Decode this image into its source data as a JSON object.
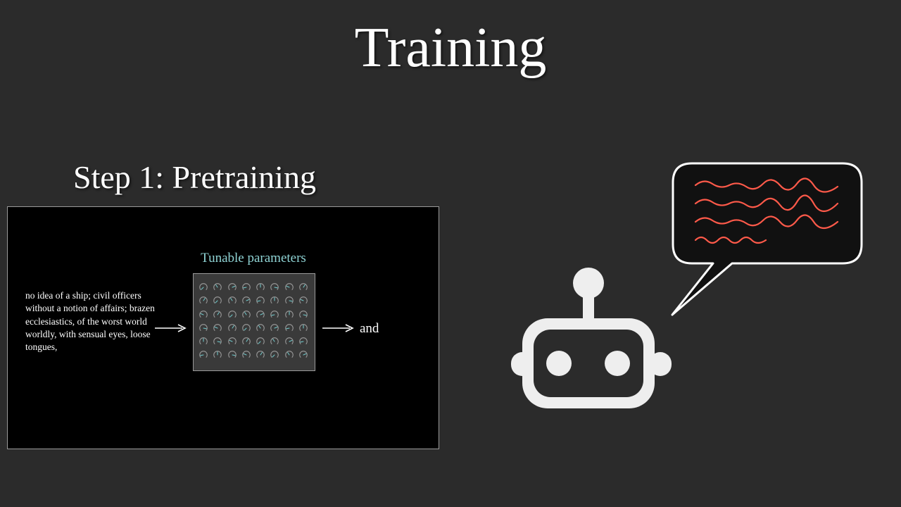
{
  "slide": {
    "title": "Training",
    "step_title": "Step 1: Pretraining"
  },
  "pretraining_panel": {
    "input_text": "no idea of a ship; civil officers without a notion of affairs; brazen ecclesiastics, of the worst world worldly, with sensual eyes, loose tongues,",
    "parameters_label": "Tunable parameters",
    "output_token": "and",
    "dial_grid": {
      "rows": 6,
      "cols": 8
    }
  },
  "icons": {
    "robot": "robot-icon",
    "speech_bubble": "speech-bubble-icon",
    "dial": "dial-icon",
    "arrow": "arrow-right-icon"
  },
  "colors": {
    "background": "#2b2b2b",
    "panel_background": "#000000",
    "parameters_label": "#8fd3d4",
    "speech_lines": "#ff5a4a",
    "robot_fill": "#eeeeee",
    "dial_accent": "#6fc7c9"
  }
}
